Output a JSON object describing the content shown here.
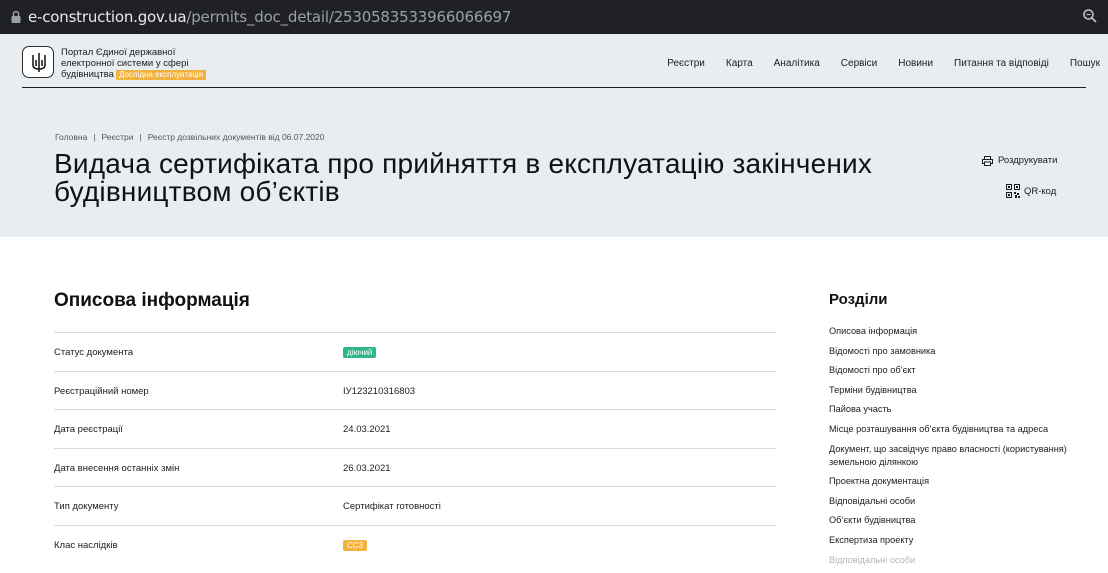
{
  "browser": {
    "url_host": "e-construction.gov.ua",
    "url_path": "/permits_doc_detail/2530583533966066697"
  },
  "header": {
    "portal_line1": "Портал Єдиної державної",
    "portal_line2": "електронної системи у сфері",
    "portal_line3": "будівництва",
    "beta_badge": "Дослідна експлуатація",
    "nav": [
      "Реєстри",
      "Карта",
      "Аналітика",
      "Сервіси",
      "Новини",
      "Питання та відповіді",
      "Пошук"
    ]
  },
  "breadcrumb": [
    "Головна",
    "Реєстри",
    "Реєстр дозвільних документів від 06.07.2020"
  ],
  "page": {
    "title": "Видача сертифіката про прийняття в експлуатацію закінчених будівництвом об’єктів",
    "print_label": "Роздрукувати",
    "qr_label": "QR-код"
  },
  "section": {
    "title": "Описова інформація",
    "rows": [
      {
        "label": "Статус документа",
        "value": "діючий",
        "type": "pill-green"
      },
      {
        "label": "Реєстраційний номер",
        "value": "ІУ123210316803",
        "type": "text"
      },
      {
        "label": "Дата реєстрації",
        "value": "24.03.2021",
        "type": "text"
      },
      {
        "label": "Дата внесення останніх змін",
        "value": "26.03.2021",
        "type": "text"
      },
      {
        "label": "Тип документу",
        "value": "Сертифікат готовності",
        "type": "text"
      },
      {
        "label": "Клас наслідків",
        "value": "СС3",
        "type": "pill-orange"
      }
    ]
  },
  "toc": {
    "title": "Розділи",
    "items": [
      "Описова інформація",
      "Відомості про замовника",
      "Відомості про об’єкт",
      "Терміни будівництва",
      "Пайова участь",
      "Місце розташування об’єкта будівництва та адреса",
      "Документ, що засвідчує право власності (користування) земельною ділянкою",
      "Проектна документація",
      "Відповідальні особи",
      "Об’єкти будівництва",
      "Експертиза проекту",
      "Відповідальні особи"
    ]
  },
  "colors": {
    "header_bg": "#e8edf1",
    "status_green": "#2fb68a",
    "class_orange": "#f3b23d"
  }
}
